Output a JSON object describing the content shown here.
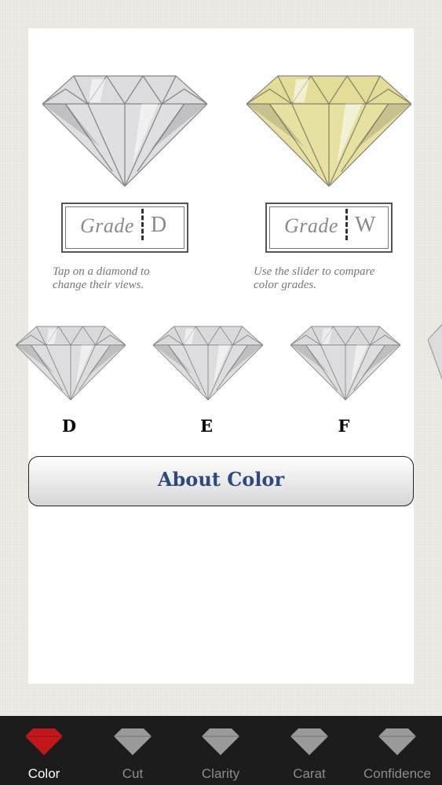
{
  "viewer": {
    "left_grade": {
      "label": "Grade",
      "value": "D"
    },
    "right_grade": {
      "label": "Grade",
      "value": "W"
    },
    "left_hint": "Tap on a diamond to change their views.",
    "right_hint": "Use the slider to compare color grades."
  },
  "slider": {
    "items": [
      {
        "grade": "D"
      },
      {
        "grade": "E"
      },
      {
        "grade": "F"
      }
    ]
  },
  "about_button": {
    "label": "About Color"
  },
  "tabbar": {
    "tabs": [
      {
        "label": "Color",
        "icon": "diamond-icon",
        "active": true
      },
      {
        "label": "Cut",
        "icon": "diamond-icon"
      },
      {
        "label": "Clarity",
        "icon": "diamond-icon"
      },
      {
        "label": "Carat",
        "icon": "diamond-icon"
      },
      {
        "label": "Confidence",
        "icon": "diamond-icon"
      }
    ]
  },
  "colors": {
    "active_tab_icon": "#c4161c",
    "inactive_tab_icon": "#9a9a9a",
    "button_text": "#2e4a7a",
    "yellow_diamond": "#e9e4a6"
  }
}
